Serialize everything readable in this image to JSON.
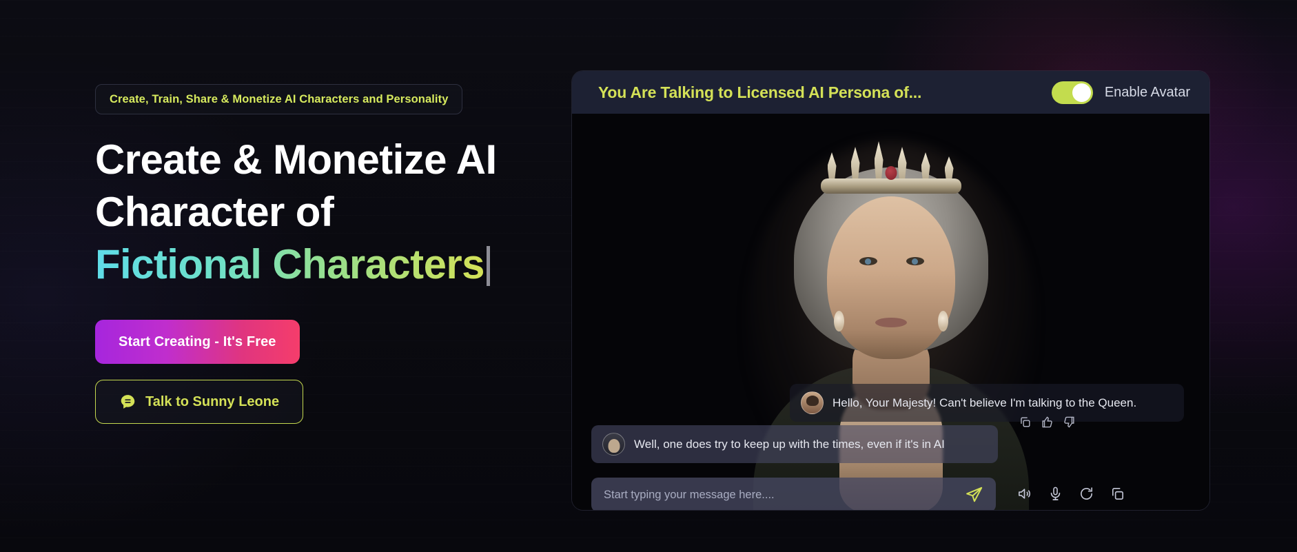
{
  "hero": {
    "badge": "Create, Train, Share & Monetize AI Characters and Personality",
    "headline_line1": "Create & Monetize AI",
    "headline_line2": "Character of",
    "headline_line3_typed": "Fictional Characters",
    "primary_cta": "Start Creating - It's Free",
    "secondary_cta": "Talk to Sunny Leone",
    "colors": {
      "accent_lime": "#d4e157",
      "gradient_start": "#5fdde8",
      "gradient_end": "#d4e157",
      "cta_gradient_start": "#a626dd",
      "cta_gradient_end": "#f53d6b",
      "page_background": "#0a0a10"
    }
  },
  "chat_panel": {
    "title": "You Are Talking to Licensed AI Persona of...",
    "toggle_label": "Enable Avatar",
    "toggle_state": "on",
    "header_background": "#1d2133",
    "messages": [
      {
        "role": "user",
        "text": "Hello, Your Majesty! Can't believe I'm talking to the Queen.",
        "avatar": "user-avatar"
      },
      {
        "role": "assistant",
        "text": "Well, one does try to keep up with the times, even if it's in AI",
        "avatar": "assistant-avatar"
      }
    ],
    "message_actions": [
      "copy-icon",
      "thumbs-up-icon",
      "thumbs-down-icon"
    ],
    "composer": {
      "placeholder": "Start typing your message here....",
      "value": "",
      "send_icon": "send-icon"
    },
    "composer_tools": [
      "speaker-icon",
      "microphone-icon",
      "refresh-icon",
      "copy-icon"
    ]
  }
}
